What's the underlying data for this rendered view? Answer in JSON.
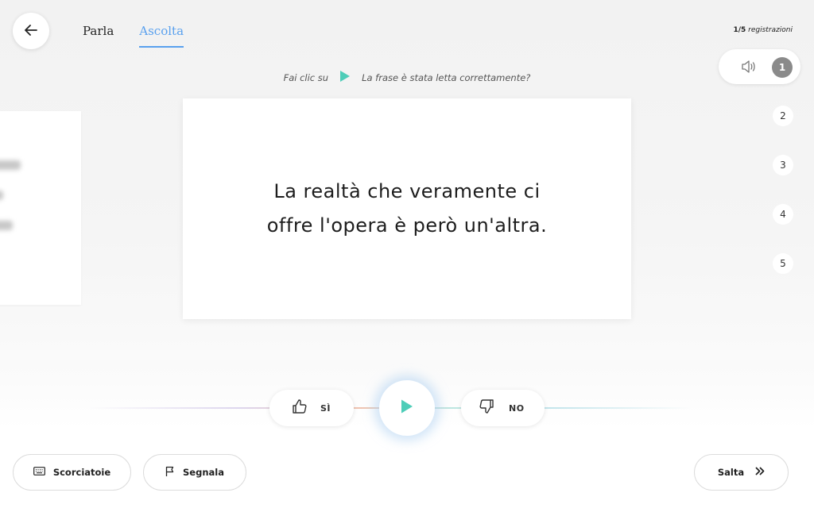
{
  "header": {
    "tabs": [
      {
        "label": "Parla",
        "active": false
      },
      {
        "label": "Ascolta",
        "active": true
      }
    ],
    "counter": {
      "current": "1/5",
      "label": "registrazioni"
    }
  },
  "instruction": {
    "prefix": "Fai clic su",
    "question": "La frase è stata letta correttamente?"
  },
  "card": {
    "line1": "La realtà che veramente ci",
    "line2": "offre l'opera è però un'altra."
  },
  "recordings": {
    "active": "1",
    "others": [
      "2",
      "3",
      "4",
      "5"
    ]
  },
  "controls": {
    "yes_label": "SÌ",
    "no_label": "NO"
  },
  "footer": {
    "shortcuts_label": "Scorciatoie",
    "report_label": "Segnala",
    "skip_label": "Salta"
  },
  "colors": {
    "accent_blue": "#59a0ee",
    "play_teal": "#4ecdb8",
    "active_rec_gray": "#8a8a8a"
  },
  "icons": {
    "back": "arrow-left-icon",
    "speaker": "speaker-icon",
    "play": "play-icon",
    "thumbs_up": "thumbs-up-icon",
    "thumbs_down": "thumbs-down-icon",
    "keyboard": "keyboard-icon",
    "flag": "flag-icon",
    "skip": "double-chevron-right-icon"
  }
}
